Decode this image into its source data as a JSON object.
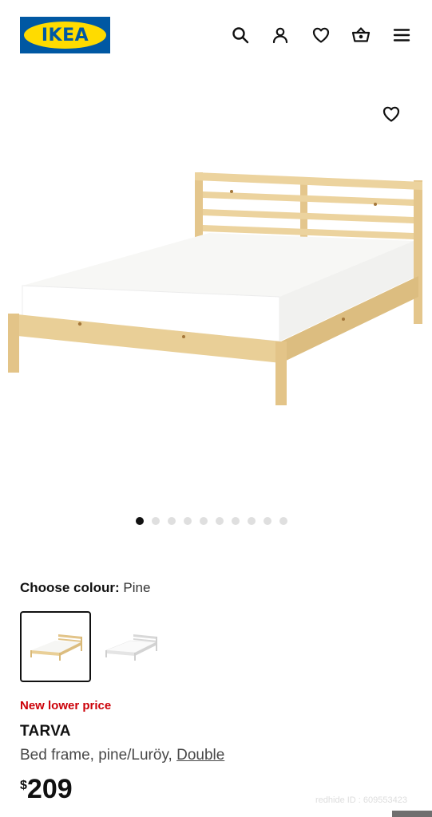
{
  "header": {
    "logo_text": "IKEA",
    "icons": [
      "search-icon",
      "user-icon",
      "heart-icon",
      "basket-icon",
      "menu-icon"
    ]
  },
  "gallery": {
    "image_count": 10,
    "active_index": 0
  },
  "colour": {
    "label": "Choose colour:",
    "value": "Pine",
    "options": [
      {
        "name": "Pine",
        "selected": true
      },
      {
        "name": "White",
        "selected": false
      }
    ]
  },
  "product": {
    "badge": "New lower price",
    "name": "TARVA",
    "description": "Bed frame, pine/Luröy, ",
    "size": "Double",
    "currency": "$",
    "price": "209"
  },
  "watermark": "redhide ID : 609553423",
  "colors": {
    "brand_blue": "#0058a3",
    "brand_yellow": "#ffdb00",
    "price_red": "#cc0008",
    "pine": "#e9cf97"
  }
}
